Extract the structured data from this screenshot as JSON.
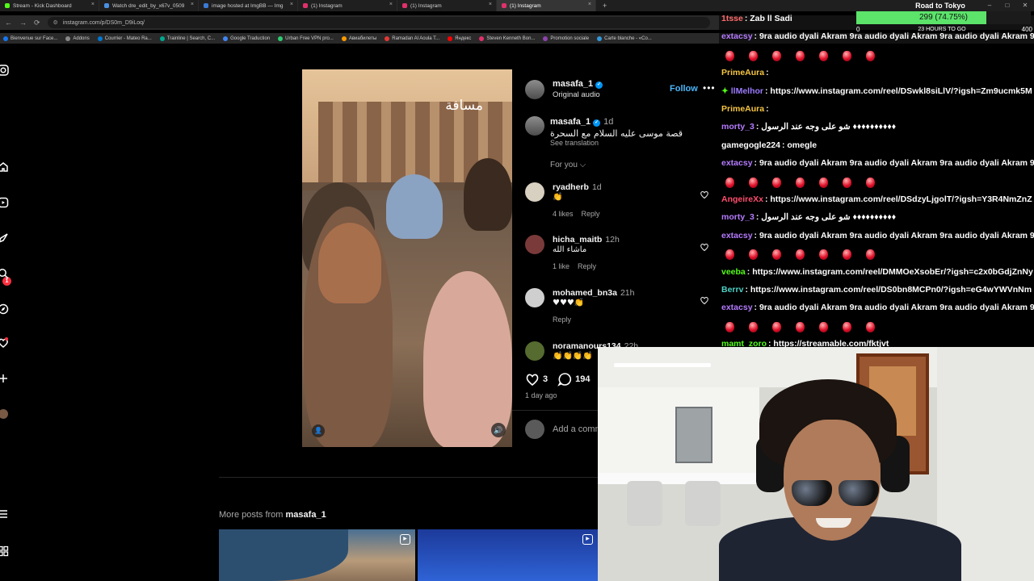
{
  "browser": {
    "tabs": [
      {
        "title": "Stream - Kick Dashboard",
        "color": "#53fc18",
        "active": false
      },
      {
        "title": "Watch dre_edit_by_x67v_0509",
        "color": "#4a90e2",
        "active": false
      },
      {
        "title": "image hosted at ImgBB — Img",
        "color": "#3a7bd5",
        "active": false
      },
      {
        "title": "(1) Instagram",
        "color": "#e1306c",
        "active": false
      },
      {
        "title": "(1) Instagram",
        "color": "#e1306c",
        "active": false
      },
      {
        "title": "(1) Instagram",
        "color": "#e1306c",
        "active": true
      }
    ],
    "url": "instagram.com/p/DS0m_D9iLoq/",
    "bookmarks": [
      {
        "label": "Bienvenue sur Face...",
        "color": "#1877f2"
      },
      {
        "label": "Addons",
        "color": "#888888"
      },
      {
        "label": "Courrier - Mateo Ra...",
        "color": "#0078d4"
      },
      {
        "label": "Trainline | Search, C...",
        "color": "#00a88f"
      },
      {
        "label": "Google Traduction",
        "color": "#4285f4"
      },
      {
        "label": "Urban Free VPN pro...",
        "color": "#2ecc71"
      },
      {
        "label": "Авиабилеты",
        "color": "#ff9900"
      },
      {
        "label": "Ramadan Al Aoula T...",
        "color": "#e53935"
      },
      {
        "label": "Яндекс",
        "color": "#ff0000"
      },
      {
        "label": "Steven Kenneth Bon...",
        "color": "#e1306c"
      },
      {
        "label": "Promotion sociale",
        "color": "#8e44ad"
      },
      {
        "label": "Carte blanche - «Co...",
        "color": "#3498db"
      }
    ]
  },
  "rail": {
    "notification_count": "1"
  },
  "post": {
    "video_overlay_text": "مسافة",
    "author": "masafa_1",
    "audio": "Original audio",
    "follow_label": "Follow",
    "caption": {
      "author": "masafa_1",
      "time": "1d",
      "text": "قصة موسى عليه السلام مع السحرة",
      "translation": "See translation"
    },
    "sort_label": "For you ⌵",
    "comments": [
      {
        "user": "ryadherb",
        "time": "1d",
        "text": "👏",
        "likes": "4 likes",
        "reply": "Reply",
        "avatar_color": "#d8d0c0"
      },
      {
        "user": "hicha_maitb",
        "time": "12h",
        "text": "ماشاء الله",
        "likes": "1 like",
        "reply": "Reply",
        "avatar_color": "#7a3a3a"
      },
      {
        "user": "mohamed_bn3a",
        "time": "21h",
        "text": "♥♥♥👏",
        "likes": "",
        "reply": "Reply",
        "avatar_color": "#cfcfcf"
      },
      {
        "user": "noramanours134",
        "time": "22h",
        "text": "👏👏👏👏",
        "likes": "",
        "reply": "",
        "avatar_color": "#556b2f"
      }
    ],
    "like_count": "3",
    "comment_count": "194",
    "posted": "1 day ago",
    "add_comment_placeholder": "Add a comment..."
  },
  "more_posts": {
    "prefix": "More posts from",
    "author": "masafa_1"
  },
  "chat": {
    "messages": [
      {
        "user": "1tsse",
        "user_color": "#ff6b6b",
        "text": ": Zab ll Sadi",
        "type": "text"
      },
      {
        "user": "extacsy",
        "user_color": "#b57bff",
        "text": ": 9ra audio dyali Akram 9ra audio dyali Akram 9ra audio dyali Akram 9",
        "type": "text"
      },
      {
        "type": "emoji"
      },
      {
        "user": "PrimeAura",
        "user_color": "#f5c542",
        "text": ": ",
        "type": "text"
      },
      {
        "user": "llMelhor",
        "user_color": "#9b7bff",
        "text": ": https://www.instagram.com/reel/DSwkl8siLlV/?igsh=Zm9ucmk5M",
        "type": "text",
        "gift": "✦"
      },
      {
        "user": "PrimeAura",
        "user_color": "#f5c542",
        "text": ": ",
        "type": "text"
      },
      {
        "user": "morty_3",
        "user_color": "#b57bff",
        "text": ": شو على وجه عند الرسول ♦♦♦♦♦♦♦♦♦♦",
        "type": "text"
      },
      {
        "user": "gamegogle224",
        "user_color": "#ffffff",
        "text": ": omegle",
        "type": "text"
      },
      {
        "user": "extacsy",
        "user_color": "#b57bff",
        "text": ": 9ra audio dyali Akram 9ra audio dyali Akram 9ra audio dyali Akram 9",
        "type": "text"
      },
      {
        "type": "emoji"
      },
      {
        "user": "AngeireXx",
        "user_color": "#ff4d6d",
        "text": ": https://www.instagram.com/reel/DSdzyLjgolT/?igsh=Y3R4NmZnZ",
        "type": "text"
      },
      {
        "user": "morty_3",
        "user_color": "#b57bff",
        "text": ": شو على وجه عند الرسول ♦♦♦♦♦♦♦♦♦♦",
        "type": "text"
      },
      {
        "user": "extacsy",
        "user_color": "#b57bff",
        "text": ": 9ra audio dyali Akram 9ra audio dyali Akram 9ra audio dyali Akram 9",
        "type": "text"
      },
      {
        "type": "emoji"
      },
      {
        "user": "veeba",
        "user_color": "#53fc18",
        "text": ": https://www.instagram.com/reel/DMMOeXsobEr/?igsh=c2x0bGdjZnNy",
        "type": "text"
      },
      {
        "user": "Berrv",
        "user_color": "#4fd1c5",
        "text": ": https://www.instagram.com/reel/DS0bn8MCPn0/?igsh=eG4wYWVnNm",
        "type": "text"
      },
      {
        "user": "extacsy",
        "user_color": "#b57bff",
        "text": ": 9ra audio dyali Akram 9ra audio dyali Akram 9ra audio dyali Akram 9",
        "type": "text"
      },
      {
        "type": "emoji"
      },
      {
        "user": "mamt_zoro",
        "user_color": "#53fc18",
        "text": ": https://streamable.com/fktjvt",
        "type": "text"
      }
    ]
  },
  "goal": {
    "title": "Road to Tokyo",
    "progress_text": "299 (74.75%)",
    "progress": 0.7475,
    "min": "0",
    "max": "400",
    "subtitle": "23 HOURS TO GO",
    "fill_color": "#5be36a"
  }
}
